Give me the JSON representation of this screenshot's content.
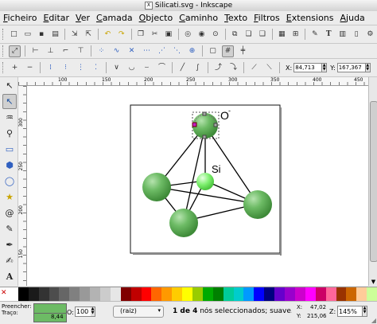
{
  "window": {
    "title": "Silicati.svg - Inkscape"
  },
  "menu": [
    "Ficheiro",
    "Editar",
    "Ver",
    "Camada",
    "Objecto",
    "Caminho",
    "Texto",
    "Filtros",
    "Extensions",
    "Ajuda"
  ],
  "ruler": {
    "h_labels": [
      "100",
      "150",
      "200",
      "250",
      "300",
      "350",
      "400",
      "450"
    ],
    "v_labels": [
      "300",
      "250",
      "200",
      "150"
    ]
  },
  "coords": {
    "x_label": "X:",
    "x_value": "84,713",
    "y_label": "Y:",
    "y_value": "167,367"
  },
  "drawing": {
    "oxygen_label": "O",
    "oxygen_superscript": "-",
    "silicon_label": "Si"
  },
  "palette": [
    "#ffffff",
    "#000000",
    "#1a1a1a",
    "#333333",
    "#4d4d4d",
    "#666666",
    "#808080",
    "#999999",
    "#b3b3b3",
    "#cccccc",
    "#e6e6e6",
    "#800000",
    "#c00000",
    "#ff0000",
    "#ff6600",
    "#ff9900",
    "#ffcc00",
    "#ffff00",
    "#99cc00",
    "#00aa00",
    "#008000",
    "#00cc99",
    "#00cccc",
    "#0099ff",
    "#0000ff",
    "#000080",
    "#6600cc",
    "#9900cc",
    "#cc00cc",
    "#ff00ff",
    "#cc0066",
    "#ff6699",
    "#993300",
    "#cc6600",
    "#ffcc99",
    "#ccff99"
  ],
  "status": {
    "fill_label": "Preencher:",
    "stroke_label": "Traço:",
    "stroke_width": "8,44",
    "opacity_label": "O:",
    "opacity_value": "100",
    "layer": "(raiz)",
    "message_bold": "1 de 4",
    "message_rest": " nós seleccionados; suave. ...",
    "coord_x_label": "X:",
    "coord_x": "47,02",
    "coord_y_label": "Y:",
    "coord_y": "215,06",
    "zoom_label": "Z:",
    "zoom": "145%"
  }
}
